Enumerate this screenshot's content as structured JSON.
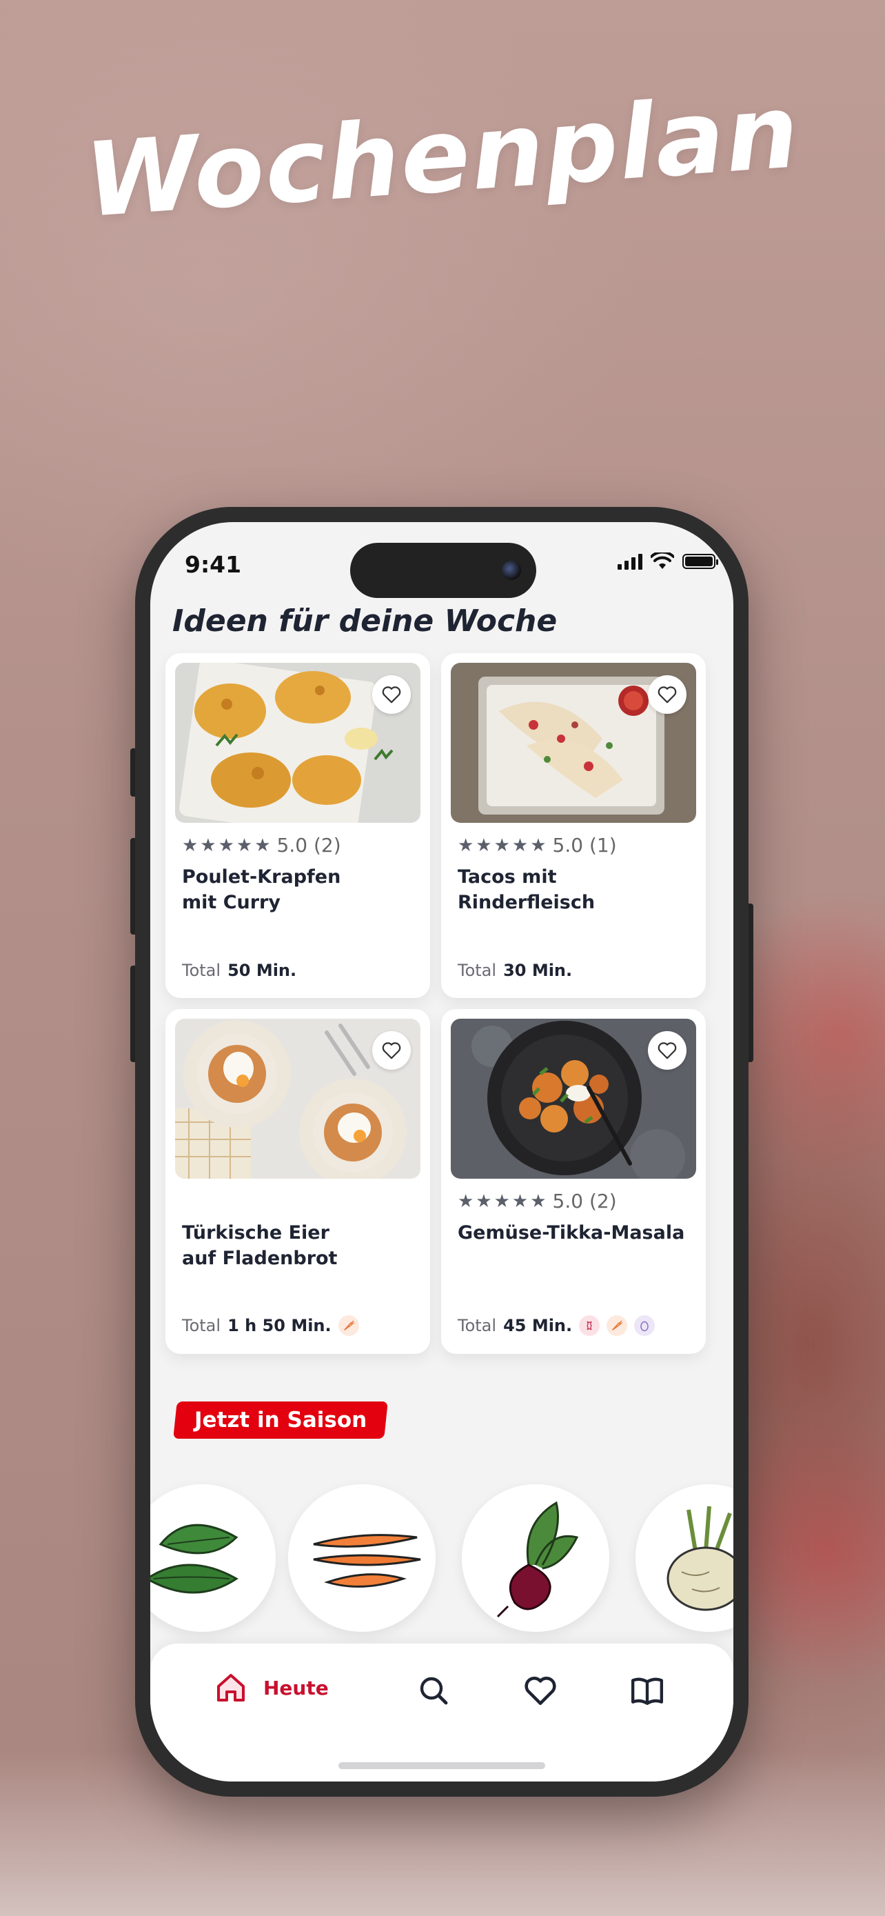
{
  "headline": "Wochenplan",
  "status_bar": {
    "time": "9:41"
  },
  "section": {
    "title": "Ideen für deine Woche"
  },
  "recipes": [
    {
      "title": "Poulet-Krapfen\nmit Curry",
      "stars": "★★★★★",
      "rating": "5.0 (2)",
      "total_label": "Total",
      "total_value": "50 Min.",
      "tags": []
    },
    {
      "title": "Tacos mit Rinderfleisch",
      "stars": "★★★★★",
      "rating": "5.0 (1)",
      "total_label": "Total",
      "total_value": "30 Min.",
      "tags": []
    },
    {
      "title": "Türkische Eier\nauf Fladenbrot",
      "stars": "",
      "rating": "",
      "total_label": "Total",
      "total_value": "1 h 50 Min.",
      "tags": [
        "carrot-icon"
      ]
    },
    {
      "title": "Gemüse-Tikka-Masala",
      "stars": "★★★★★",
      "rating": "5.0 (2)",
      "total_label": "Total",
      "total_value": "45 Min.",
      "tags": [
        "apple-core-icon",
        "carrot-icon",
        "egg-icon"
      ]
    }
  ],
  "season": {
    "badge": "Jetzt in Saison",
    "items": [
      "spinach-icon",
      "carrot-icon",
      "beetroot-icon",
      "celeriac-icon"
    ]
  },
  "tabbar": {
    "home_label": "Heute",
    "accent": "#c8102e",
    "items": [
      "home-icon",
      "search-icon",
      "heart-icon",
      "book-icon"
    ]
  },
  "colors": {
    "brand_red": "#e3000f",
    "text_dark": "#1f2433"
  }
}
